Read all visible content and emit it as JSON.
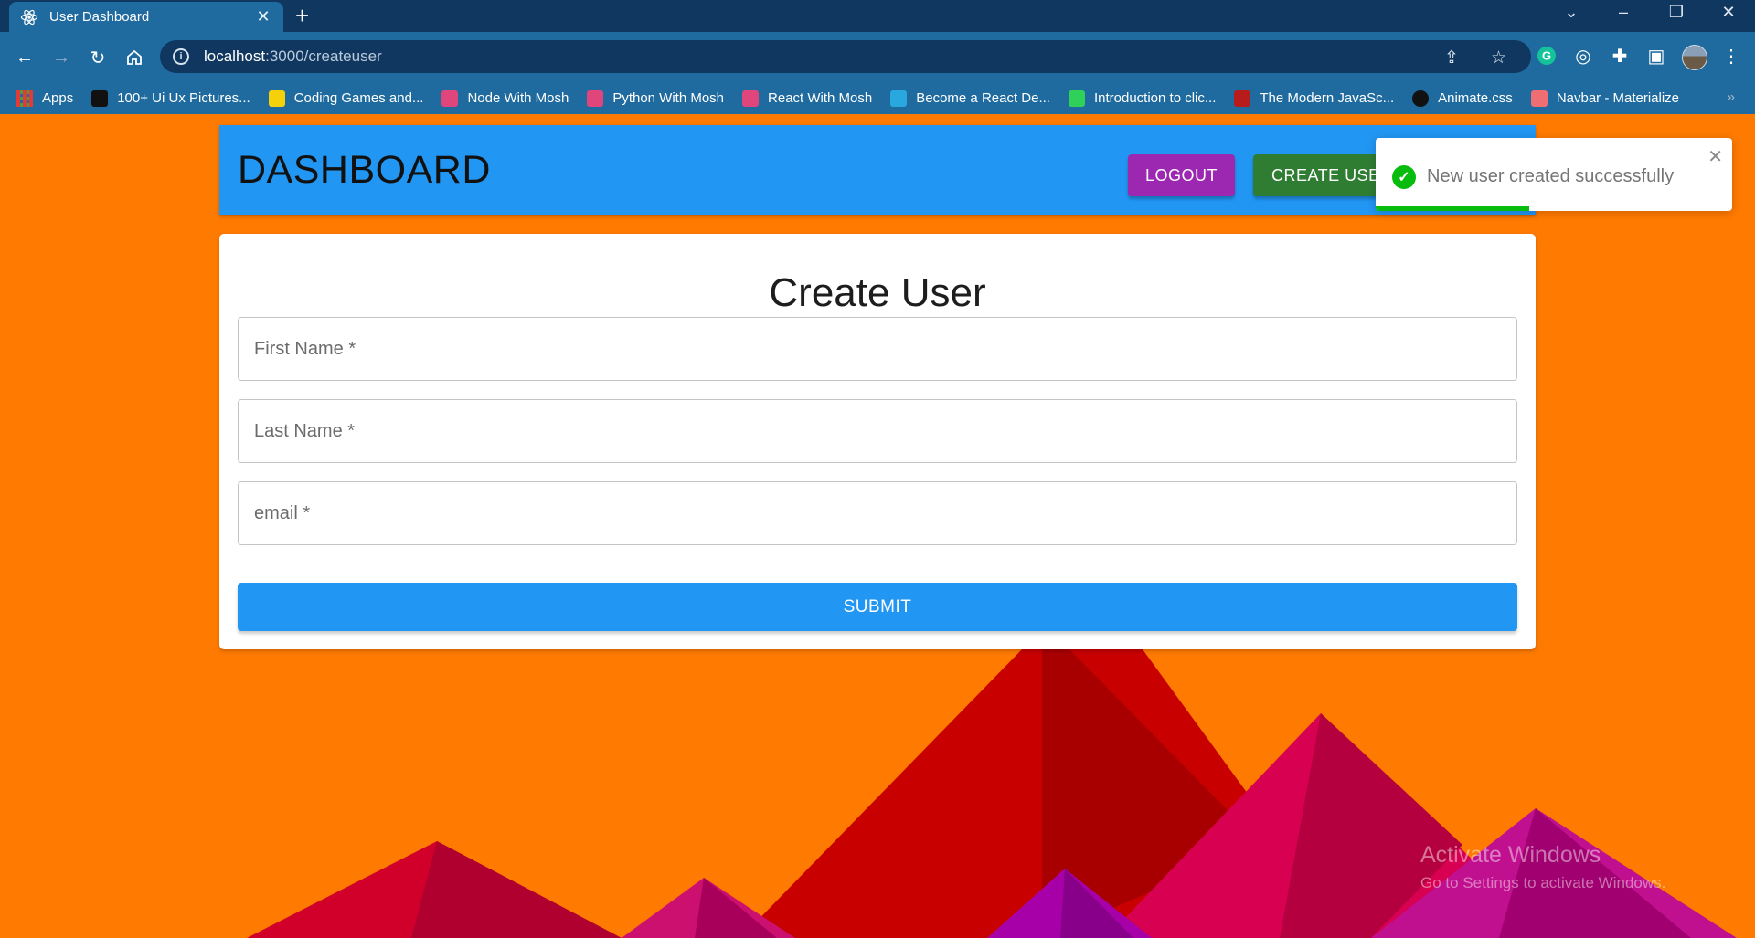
{
  "browser": {
    "tab": {
      "title": "User Dashboard",
      "favicon": "react-icon"
    },
    "url": {
      "host": "localhost",
      "path": ":3000/createuser"
    },
    "bookmarks": [
      {
        "label": "Apps",
        "color": "#e53935"
      },
      {
        "label": "100+ Ui Ux Pictures...",
        "color": "#111111"
      },
      {
        "label": "Coding Games and...",
        "color": "#f6d10a"
      },
      {
        "label": "Node With Mosh",
        "color": "#e0457b"
      },
      {
        "label": "Python With Mosh",
        "color": "#e0457b"
      },
      {
        "label": "React With Mosh",
        "color": "#e0457b"
      },
      {
        "label": "Become a React De...",
        "color": "#29a8e0"
      },
      {
        "label": "Introduction to clic...",
        "color": "#2fd158"
      },
      {
        "label": "The Modern JavaSc...",
        "color": "#b71c1c"
      },
      {
        "label": "Animate.css",
        "color": "#111111"
      },
      {
        "label": "Navbar - Materialize",
        "color": "#ee6e73"
      }
    ]
  },
  "appbar": {
    "brand": "DASHBOARD",
    "logout_label": "LOGOUT",
    "create_label": "CREATE USER"
  },
  "form": {
    "title": "Create User",
    "first_name_placeholder": "First Name *",
    "last_name_placeholder": "Last Name *",
    "email_placeholder": "email *",
    "submit_label": "SUBMIT"
  },
  "toast": {
    "message": "New user created successfully",
    "progress": 0.43
  },
  "watermark": {
    "line1": "Activate Windows",
    "line2": "Go to Settings to activate Windows."
  },
  "colors": {
    "background": "#ff7a00",
    "appbar": "#2196f3",
    "logout": "#9c27b0",
    "create": "#2e7d32",
    "success": "#07bc0c"
  }
}
